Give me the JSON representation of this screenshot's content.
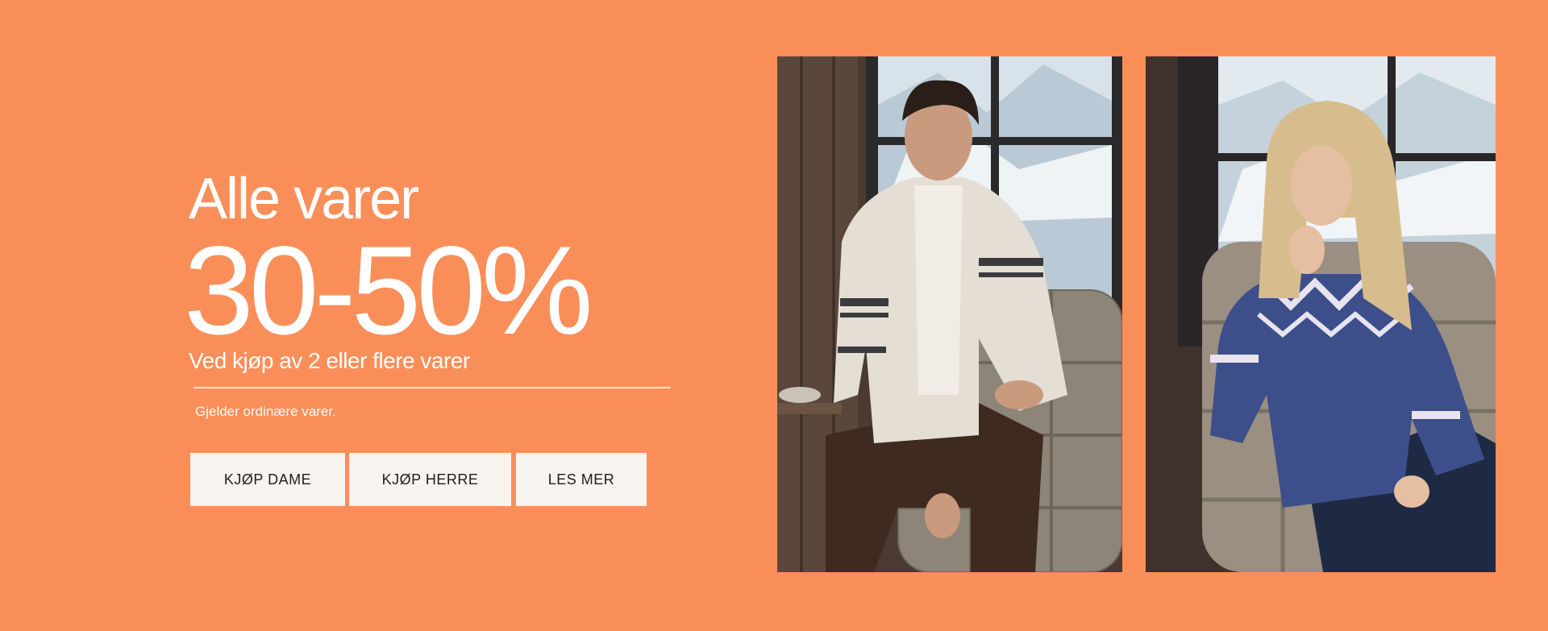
{
  "promo": {
    "headline": "Alle varer",
    "discount": "30-50%",
    "subline": "Ved kjøp av 2 eller flere varer",
    "fineprint": "Gjelder ordinære varer."
  },
  "buttons": {
    "shop_women": "KJØP DAME",
    "shop_men": "KJØP HERRE",
    "read_more": "LES MER"
  },
  "colors": {
    "background": "#FA8E59",
    "button_bg": "#F7F3EF",
    "text": "#FFFFFF"
  }
}
